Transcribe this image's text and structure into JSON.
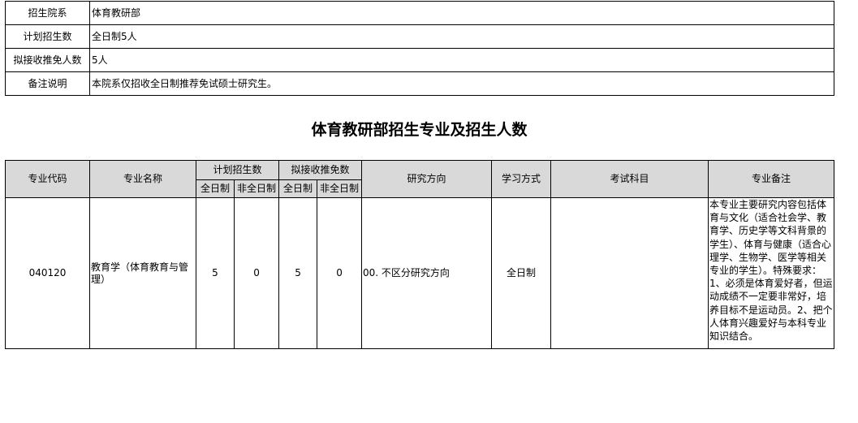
{
  "info": {
    "rows": [
      {
        "label": "招生院系",
        "value": "体育教研部"
      },
      {
        "label": "计划招生数",
        "value": "全日制5人"
      },
      {
        "label": "拟接收推免人数",
        "value": "5人"
      },
      {
        "label": "备注说明",
        "value": "本院系仅招收全日制推荐免试硕士研究生。"
      }
    ]
  },
  "section": {
    "title": "体育教研部招生专业及招生人数"
  },
  "majors": {
    "headers": {
      "code": "专业代码",
      "name": "专业名称",
      "plan_group": "计划招生数",
      "recommend_group": "拟接收推免数",
      "full_time": "全日制",
      "part_time": "非全日制",
      "direction": "研究方向",
      "study_mode": "学习方式",
      "exam_subjects": "考试科目",
      "remarks": "专业备注"
    },
    "rows": [
      {
        "code": "040120",
        "name": "教育学（体育教育与管理）",
        "plan_full": "5",
        "plan_part": "0",
        "rec_full": "5",
        "rec_part": "0",
        "direction": "00. 不区分研究方向",
        "study_mode": "全日制",
        "exam_subjects": "",
        "remarks": "本专业主要研究内容包括体育与文化（适合社会学、教育学、历史学等文科背景的学生）、体育与健康（适合心理学、生物学、医学等相关专业的学生）。特殊要求：1、必须是体育爱好者，但运动成绩不一定要非常好，培养目标不是运动员。2、把个人体育兴趣爱好与本科专业知识结合。"
      }
    ]
  }
}
